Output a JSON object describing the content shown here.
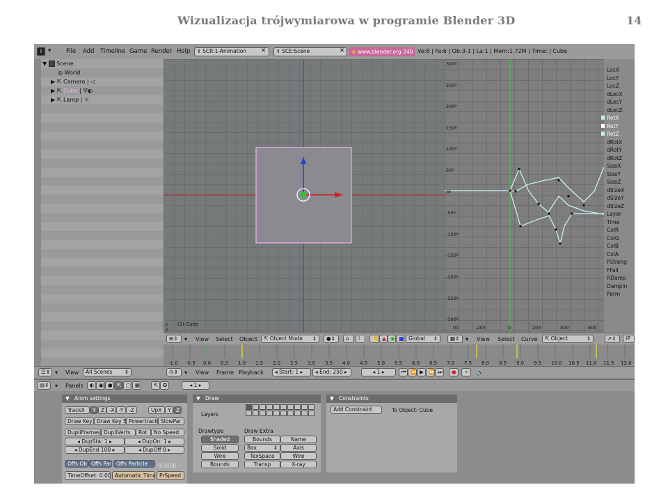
{
  "slide": {
    "title": "Wizualizacja trójwymiarowa w programie Blender 3D",
    "page_number": "14"
  },
  "topbar": {
    "menu": [
      "File",
      "Add",
      "Timeline",
      "Game",
      "Render",
      "Help"
    ],
    "screen": "SCR:1-Animation",
    "scene": "SCE:Scene",
    "website": "www.blender.org 240",
    "stats": "Ve:8 | Fa:6 | Ob:3-1 | La:1 | Mem:1.72M | Time: | Cube"
  },
  "outliner": {
    "items": [
      {
        "label": "Scene",
        "icon": "scene-icon"
      },
      {
        "label": "World",
        "icon": "world-icon"
      },
      {
        "label": "Camera",
        "icon": "camera-icon"
      },
      {
        "label": "Cube",
        "icon": "mesh-icon"
      },
      {
        "label": "Lamp",
        "icon": "lamp-icon"
      }
    ],
    "header": {
      "view": "View",
      "scene_select": "All Scenes"
    }
  },
  "viewport": {
    "object_label": "(1) Cube",
    "header": {
      "view": "View",
      "select": "Select",
      "object": "Object",
      "mode": "Object Mode",
      "orientation": "Global"
    }
  },
  "ipo": {
    "y_labels": [
      "300º",
      "250º",
      "200º",
      "150º",
      "100º",
      "50º",
      "0º",
      "-50º",
      "-100º",
      "-150º",
      "-200º",
      "-250º",
      "-300º"
    ],
    "x_labels": [
      "00",
      "-200",
      "0",
      "200",
      "400",
      "600"
    ],
    "channels": [
      "LocX",
      "LocY",
      "LocZ",
      "dLocX",
      "dLocY",
      "dLocZ",
      "RotX",
      "RotY",
      "RotZ",
      "dRotX",
      "dRotY",
      "dRotZ",
      "SizeX",
      "SizeY",
      "SizeZ",
      "dSizeX",
      "dSizeY",
      "dSizeZ",
      "Layer",
      "Time",
      "ColR",
      "ColG",
      "ColB",
      "ColA",
      "FStreng",
      "FFall",
      "RDamp",
      "Dampin",
      "Perm"
    ],
    "header": {
      "view": "View",
      "select": "Select",
      "curve": "Curve",
      "object": "Object",
      "ip": "IP"
    }
  },
  "timeline": {
    "labels": [
      "-1.0",
      "-0.5",
      "0.0",
      "0.5",
      "1.0",
      "1.5",
      "2.0",
      "2.5",
      "3.0",
      "3.5",
      "4.0",
      "4.5",
      "5.0",
      "5.5",
      "6.0",
      "6.5",
      "7.0",
      "7.5",
      "8.0",
      "8.5",
      "9.0",
      "9.5",
      "10.0",
      "10.5",
      "11.0",
      "11.5",
      "12.0"
    ],
    "header": {
      "view": "View",
      "frame": "Frame",
      "playback": "Playback",
      "start": "Start: 1",
      "end": "End: 250",
      "current": "1"
    }
  },
  "buttons": {
    "header": {
      "panels": "Panels",
      "frame": "1"
    },
    "anim_settings": {
      "title": "Anim settings",
      "track": [
        "TrackX",
        "Y",
        "Z",
        "-X",
        "-Y",
        "-Z"
      ],
      "up": [
        "UpX",
        "Y",
        "Z"
      ],
      "row2": [
        "Draw Key",
        "Draw Key S",
        "Powertrack",
        "SlowPar"
      ],
      "row3": [
        "DupliFrames",
        "DupliVerts",
        "Rot",
        "No Speed"
      ],
      "dupsta": "DupSta: 1",
      "dupon": "DupOn: 1",
      "dupend": "DupEnd 100",
      "dupoff": "DupOff 0",
      "offs": [
        "Offs Ob",
        "Offs Par",
        "Offs Particle"
      ],
      "offs_value": "0.0000",
      "timeoffset": "TimeOffset: 0.00",
      "automatic": "Automatic Time",
      "prspeed": "PrSpeed"
    },
    "draw": {
      "title": "Draw",
      "layers": "Layers",
      "drawtype_label": "Drawtype",
      "drawtype": [
        "Shaded",
        "Solid",
        "Wire",
        "Bounds"
      ],
      "drawextra_label": "Draw Extra",
      "drawextra": [
        [
          "Bounds",
          "Name"
        ],
        [
          "Box",
          "Axis"
        ],
        [
          "TexSpace",
          "Wire"
        ],
        [
          "Transp",
          "X-ray"
        ]
      ]
    },
    "constraints": {
      "title": "Constraints",
      "add": "Add Constraint",
      "to_object": "To Object: Cube"
    }
  },
  "colors": {
    "selection": "#f0b6ee",
    "curve": "#c8f0f0",
    "green": "#22cc22",
    "blue_axis": "#2a40c8",
    "red_axis": "#d02020"
  }
}
